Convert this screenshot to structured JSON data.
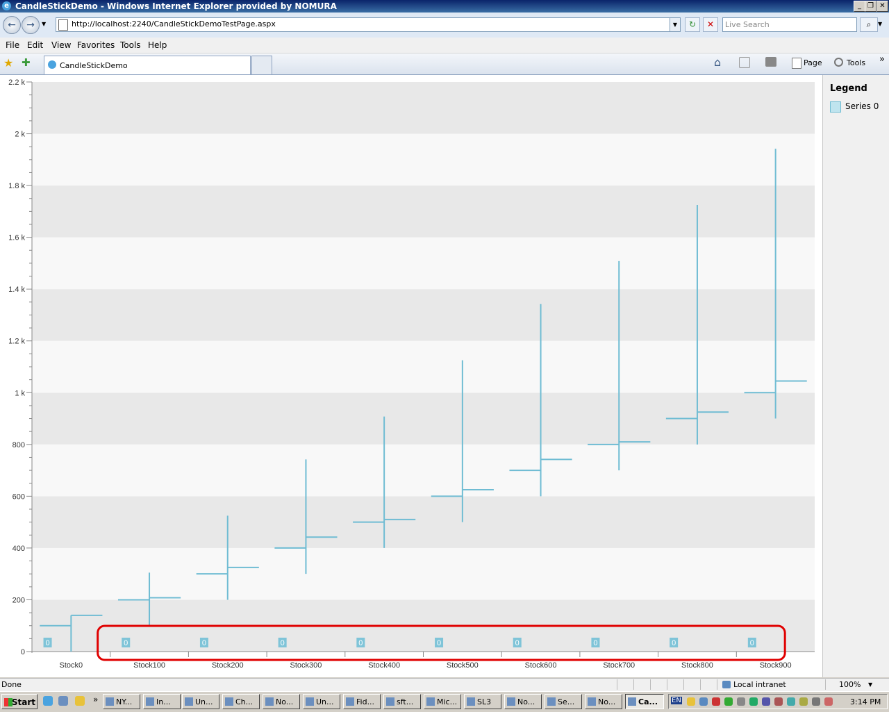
{
  "window": {
    "title": "CandleStickDemo - Windows Internet Explorer provided by NOMURA",
    "min_glyph": "_",
    "max_glyph": "❐",
    "close_glyph": "✕"
  },
  "toolbar": {
    "back_glyph": "←",
    "forward_glyph": "→",
    "refresh_glyph": "↻",
    "stop_glyph": "✕",
    "search_go_glyph": "⌕",
    "address": "http://localhost:2240/CandleStickDemoTestPage.aspx",
    "search_placeholder": "Live Search"
  },
  "menu": {
    "items": [
      "File",
      "Edit",
      "View",
      "Favorites",
      "Tools",
      "Help"
    ]
  },
  "tabs": {
    "favorites_glyph": "★",
    "add_glyph": "✚",
    "active_tab": "CandleStickDemo",
    "home_glyph": "⌂",
    "page_label": "Page",
    "tools_label": "Tools",
    "more_glyph": "»"
  },
  "legend": {
    "title": "Legend",
    "series_name": "Series 0"
  },
  "chart_data": {
    "type": "candlestick",
    "categories": [
      "Stock0",
      "Stock100",
      "Stock200",
      "Stock300",
      "Stock400",
      "Stock500",
      "Stock600",
      "Stock700",
      "Stock800",
      "Stock900"
    ],
    "series": [
      {
        "name": "Series 0",
        "open": [
          100,
          200,
          300,
          400,
          500,
          600,
          700,
          800,
          900,
          1000
        ],
        "close": [
          140,
          208,
          325,
          442,
          510,
          625,
          742,
          810,
          925,
          1045
        ],
        "high": [
          140,
          305,
          525,
          742,
          908,
          1125,
          1342,
          1508,
          1725,
          1942
        ],
        "low": [
          0,
          100,
          200,
          300,
          400,
          500,
          600,
          700,
          800,
          900
        ],
        "data_labels": [
          "0",
          "0",
          "0",
          "0",
          "0",
          "0",
          "0",
          "0",
          "0",
          "0"
        ]
      }
    ],
    "y_ticks": [
      "0",
      "200",
      "400",
      "600",
      "800",
      "1 k",
      "1.2 k",
      "1.4 k",
      "1.6 k",
      "1.8 k",
      "2 k",
      "2.2 k"
    ],
    "ylim": [
      0,
      2200
    ],
    "color": "#6fbcd3",
    "band_colors": [
      "#e8e8e8",
      "#f8f8f8"
    ],
    "highlight_color": "#e00000",
    "legend_position": "right",
    "grid": false
  },
  "status": {
    "text": "Done",
    "zone": "Local intranet",
    "zoom": "100%"
  },
  "taskbar": {
    "start": "Start",
    "tasks": [
      "NY...",
      "In...",
      "Un...",
      "Ch...",
      "No...",
      "Un...",
      "Fid...",
      "sft...",
      "Mic...",
      "SL3",
      "No...",
      "Se...",
      "No...",
      "Ca..."
    ],
    "tray_lang": "EN",
    "clock": "3:14 PM"
  }
}
